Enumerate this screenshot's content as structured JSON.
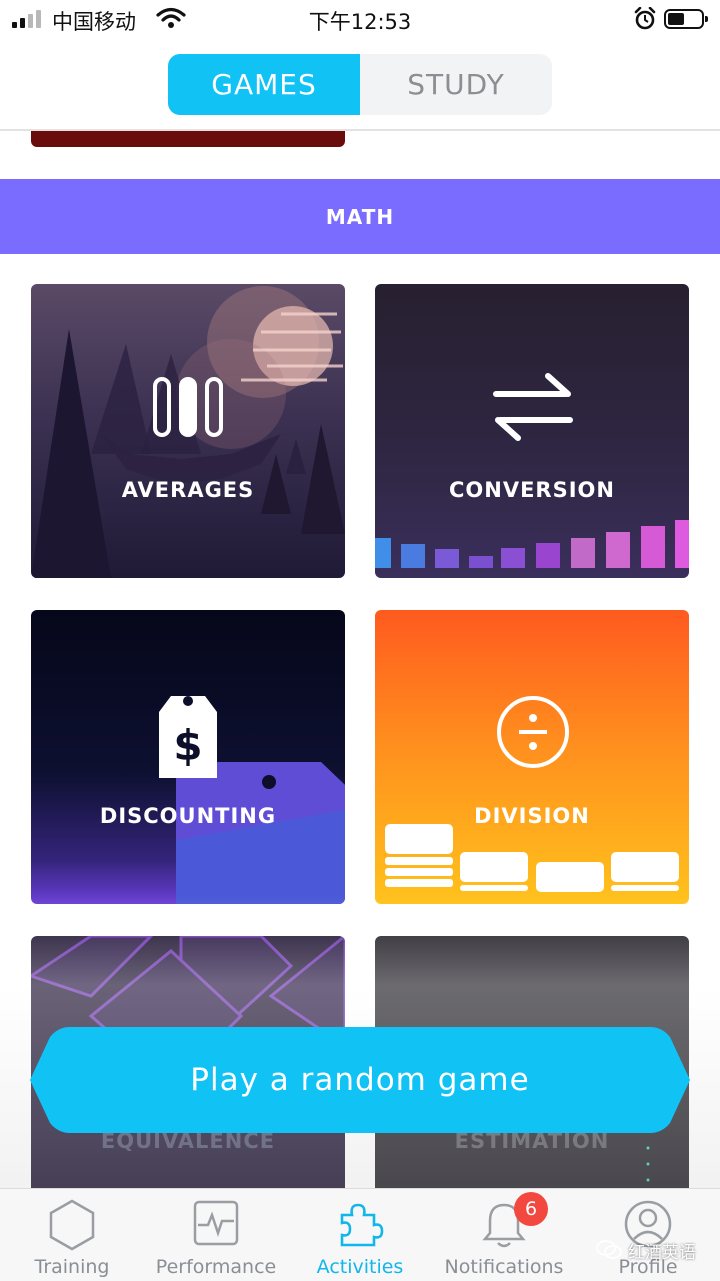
{
  "status_bar": {
    "carrier": "中国移动",
    "time": "下午12:53"
  },
  "tabs_toggle": {
    "games": "GAMES",
    "study": "STUDY",
    "active": "games"
  },
  "section": {
    "title": "MATH"
  },
  "games": [
    {
      "label": "AVERAGES"
    },
    {
      "label": "CONVERSION"
    },
    {
      "label": "DISCOUNTING"
    },
    {
      "label": "DIVISION"
    },
    {
      "label": "EQUIVALENCE"
    },
    {
      "label": "ESTIMATION"
    }
  ],
  "random_button": {
    "label": "Play a random game",
    "color": "#11c2f5"
  },
  "tab_bar": {
    "items": [
      {
        "label": "Training",
        "icon": "hexagon-icon"
      },
      {
        "label": "Performance",
        "icon": "pulse-icon"
      },
      {
        "label": "Activities",
        "icon": "puzzle-icon"
      },
      {
        "label": "Notifications",
        "icon": "bell-icon"
      },
      {
        "label": "Profile",
        "icon": "person-icon"
      }
    ],
    "active": "Activities",
    "notifications_badge": "6"
  },
  "watermark": {
    "text": "红酒英语"
  },
  "colors": {
    "accent": "#11c2f5",
    "section_band": "#7a6cff",
    "badge": "#f2483f"
  }
}
